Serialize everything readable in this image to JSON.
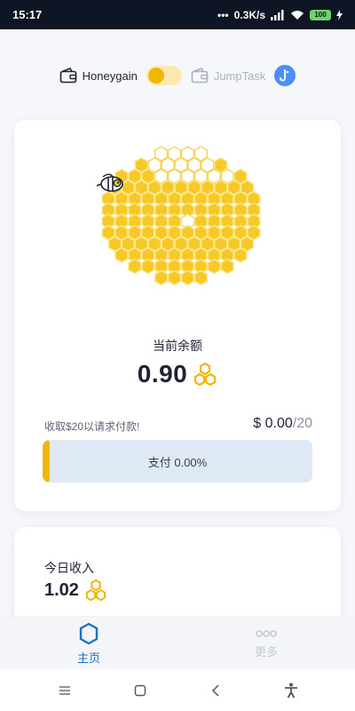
{
  "status_bar": {
    "time": "15:17",
    "network_speed": "0.3K/s",
    "battery": "100"
  },
  "header_toggle": {
    "left_label": "Honeygain",
    "right_label": "JumpTask",
    "active": "Honeygain"
  },
  "balance": {
    "label": "当前余额",
    "value": "0.90",
    "coin_icon": "honeycomb-coin-icon"
  },
  "payout": {
    "hint": "收取$20以请求付款!",
    "current": "$ 0.00",
    "target": "/20",
    "progress_label": "支付 0.00%",
    "progress_fraction": 0.0
  },
  "today": {
    "label": "今日收入",
    "value": "1.02"
  },
  "bottom_nav": {
    "items": [
      {
        "label": "主页",
        "icon": "hexagon-icon",
        "active": true
      },
      {
        "label": "更多",
        "icon": "more-dots-icon",
        "active": false
      }
    ]
  },
  "colors": {
    "accent": "#f2b705",
    "nav_active": "#1b70c9",
    "progress_bg": "#dfe8f5",
    "jumptask_blue": "#4c8ef7"
  }
}
